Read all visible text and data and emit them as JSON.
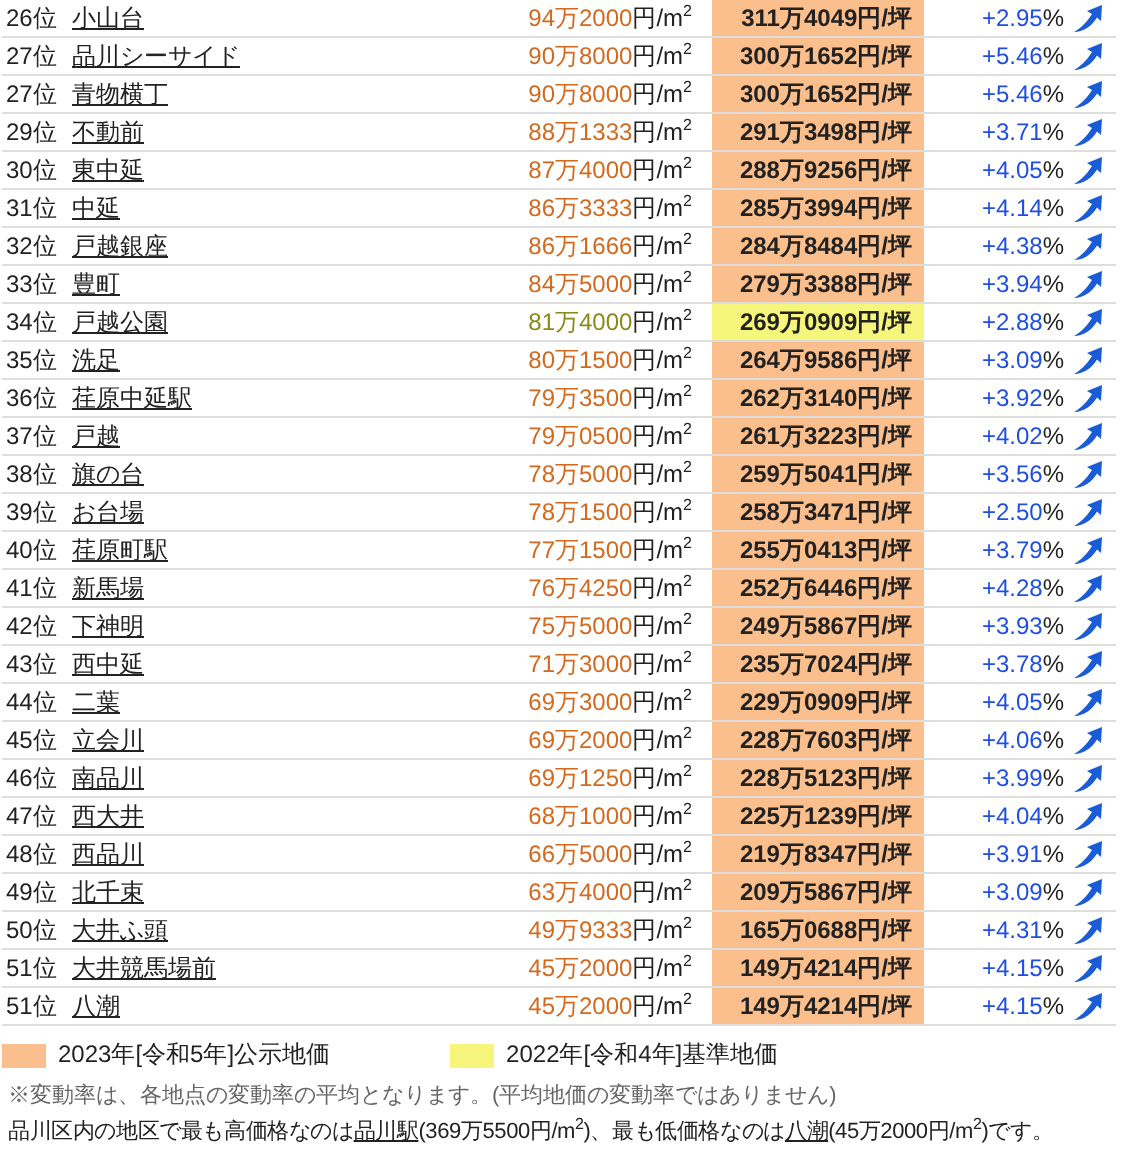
{
  "rows": [
    {
      "rank": "26位",
      "name": "小山台",
      "price": "94万2000",
      "price_unit": "円/m$^{2}$",
      "tsubo": "311万4049円/坪",
      "change": "+2.95",
      "change_unit": "%",
      "kind": "public"
    },
    {
      "rank": "27位",
      "name": "品川シーサイド",
      "price": "90万8000",
      "price_unit": "円/m$^{2}$",
      "tsubo": "300万1652円/坪",
      "change": "+5.46",
      "change_unit": "%",
      "kind": "public"
    },
    {
      "rank": "27位",
      "name": "青物横丁",
      "price": "90万8000",
      "price_unit": "円/m$^{2}$",
      "tsubo": "300万1652円/坪",
      "change": "+5.46",
      "change_unit": "%",
      "kind": "public"
    },
    {
      "rank": "29位",
      "name": "不動前",
      "price": "88万1333",
      "price_unit": "円/m$^{2}$",
      "tsubo": "291万3498円/坪",
      "change": "+3.71",
      "change_unit": "%",
      "kind": "public"
    },
    {
      "rank": "30位",
      "name": "東中延",
      "price": "87万4000",
      "price_unit": "円/m$^{2}$",
      "tsubo": "288万9256円/坪",
      "change": "+4.05",
      "change_unit": "%",
      "kind": "public"
    },
    {
      "rank": "31位",
      "name": "中延",
      "price": "86万3333",
      "price_unit": "円/m$^{2}$",
      "tsubo": "285万3994円/坪",
      "change": "+4.14",
      "change_unit": "%",
      "kind": "public"
    },
    {
      "rank": "32位",
      "name": "戸越銀座",
      "price": "86万1666",
      "price_unit": "円/m$^{2}$",
      "tsubo": "284万8484円/坪",
      "change": "+4.38",
      "change_unit": "%",
      "kind": "public"
    },
    {
      "rank": "33位",
      "name": "豊町",
      "price": "84万5000",
      "price_unit": "円/m$^{2}$",
      "tsubo": "279万3388円/坪",
      "change": "+3.94",
      "change_unit": "%",
      "kind": "public"
    },
    {
      "rank": "34位",
      "name": "戸越公園",
      "price": "81万4000",
      "price_unit": "円/m$^{2}$",
      "tsubo": "269万0909円/坪",
      "change": "+2.88",
      "change_unit": "%",
      "kind": "standard"
    },
    {
      "rank": "35位",
      "name": "洗足",
      "price": "80万1500",
      "price_unit": "円/m$^{2}$",
      "tsubo": "264万9586円/坪",
      "change": "+3.09",
      "change_unit": "%",
      "kind": "public"
    },
    {
      "rank": "36位",
      "name": "荏原中延駅",
      "price": "79万3500",
      "price_unit": "円/m$^{2}$",
      "tsubo": "262万3140円/坪",
      "change": "+3.92",
      "change_unit": "%",
      "kind": "public"
    },
    {
      "rank": "37位",
      "name": "戸越",
      "price": "79万0500",
      "price_unit": "円/m$^{2}$",
      "tsubo": "261万3223円/坪",
      "change": "+4.02",
      "change_unit": "%",
      "kind": "public"
    },
    {
      "rank": "38位",
      "name": "旗の台",
      "price": "78万5000",
      "price_unit": "円/m$^{2}$",
      "tsubo": "259万5041円/坪",
      "change": "+3.56",
      "change_unit": "%",
      "kind": "public"
    },
    {
      "rank": "39位",
      "name": "お台場",
      "price": "78万1500",
      "price_unit": "円/m$^{2}$",
      "tsubo": "258万3471円/坪",
      "change": "+2.50",
      "change_unit": "%",
      "kind": "public"
    },
    {
      "rank": "40位",
      "name": "荏原町駅",
      "price": "77万1500",
      "price_unit": "円/m$^{2}$",
      "tsubo": "255万0413円/坪",
      "change": "+3.79",
      "change_unit": "%",
      "kind": "public"
    },
    {
      "rank": "41位",
      "name": "新馬場",
      "price": "76万4250",
      "price_unit": "円/m$^{2}$",
      "tsubo": "252万6446円/坪",
      "change": "+4.28",
      "change_unit": "%",
      "kind": "public"
    },
    {
      "rank": "42位",
      "name": "下神明",
      "price": "75万5000",
      "price_unit": "円/m$^{2}$",
      "tsubo": "249万5867円/坪",
      "change": "+3.93",
      "change_unit": "%",
      "kind": "public"
    },
    {
      "rank": "43位",
      "name": "西中延",
      "price": "71万3000",
      "price_unit": "円/m$^{2}$",
      "tsubo": "235万7024円/坪",
      "change": "+3.78",
      "change_unit": "%",
      "kind": "public"
    },
    {
      "rank": "44位",
      "name": "二葉",
      "price": "69万3000",
      "price_unit": "円/m$^{2}$",
      "tsubo": "229万0909円/坪",
      "change": "+4.05",
      "change_unit": "%",
      "kind": "public"
    },
    {
      "rank": "45位",
      "name": "立会川",
      "price": "69万2000",
      "price_unit": "円/m$^{2}$",
      "tsubo": "228万7603円/坪",
      "change": "+4.06",
      "change_unit": "%",
      "kind": "public"
    },
    {
      "rank": "46位",
      "name": "南品川",
      "price": "69万1250",
      "price_unit": "円/m$^{2}$",
      "tsubo": "228万5123円/坪",
      "change": "+3.99",
      "change_unit": "%",
      "kind": "public"
    },
    {
      "rank": "47位",
      "name": "西大井",
      "price": "68万1000",
      "price_unit": "円/m$^{2}$",
      "tsubo": "225万1239円/坪",
      "change": "+4.04",
      "change_unit": "%",
      "kind": "public"
    },
    {
      "rank": "48位",
      "name": "西品川",
      "price": "66万5000",
      "price_unit": "円/m$^{2}$",
      "tsubo": "219万8347円/坪",
      "change": "+3.91",
      "change_unit": "%",
      "kind": "public"
    },
    {
      "rank": "49位",
      "name": "北千束",
      "price": "63万4000",
      "price_unit": "円/m$^{2}$",
      "tsubo": "209万5867円/坪",
      "change": "+3.09",
      "change_unit": "%",
      "kind": "public"
    },
    {
      "rank": "50位",
      "name": "大井ふ頭",
      "price": "49万9333",
      "price_unit": "円/m$^{2}$",
      "tsubo": "165万0688円/坪",
      "change": "+4.31",
      "change_unit": "%",
      "kind": "public"
    },
    {
      "rank": "51位",
      "name": "大井競馬場前",
      "price": "45万2000",
      "price_unit": "円/m$^{2}$",
      "tsubo": "149万4214円/坪",
      "change": "+4.15",
      "change_unit": "%",
      "kind": "public"
    },
    {
      "rank": "51位",
      "name": "八潮",
      "price": "45万2000",
      "price_unit": "円/m$^{2}$",
      "tsubo": "149万4214円/坪",
      "change": "+4.15",
      "change_unit": "%",
      "kind": "public"
    }
  ],
  "legend": [
    {
      "label": "2023年[令和5年]公示地価",
      "color": "#fbbf8d"
    },
    {
      "label": "2022年[令和4年]基準地価",
      "color": "#f6f67c"
    }
  ],
  "note": "※変動率は、各地点の変動率の平均となります。(平均地価の変動率ではありません)",
  "summary": [
    {
      "kind": "text",
      "text": "品川区内の地区で最も高価格なのは"
    },
    {
      "kind": "link",
      "text": "品川駅"
    },
    {
      "kind": "text",
      "text": "(369万5500円/m$^{2}$)、最も低価格なのは"
    },
    {
      "kind": "link",
      "text": "八潮"
    },
    {
      "kind": "text",
      "text": "(45万2000円/m$^{2}$)です。"
    }
  ]
}
